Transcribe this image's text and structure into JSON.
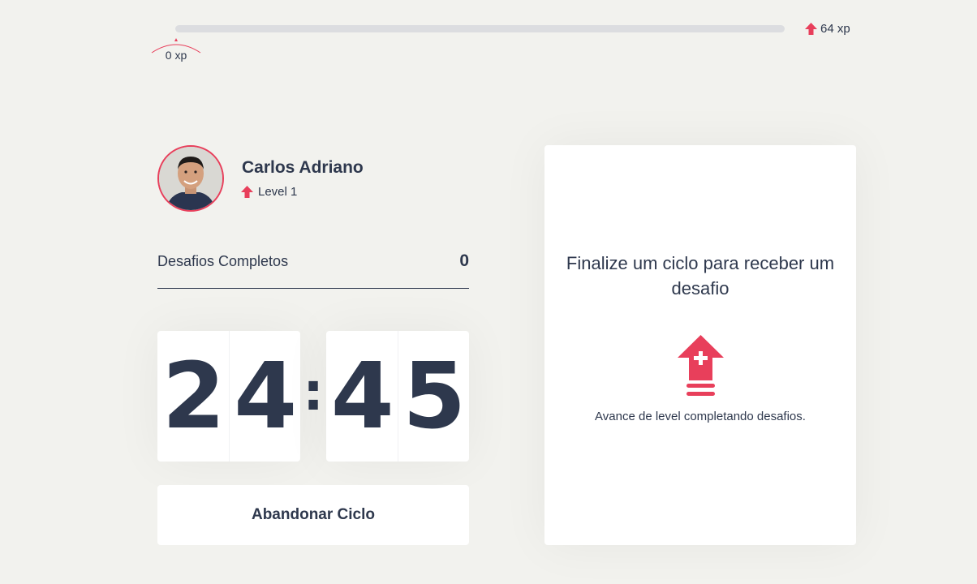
{
  "experience": {
    "current": "0 xp",
    "max": "64 xp",
    "progress_fraction": 0
  },
  "profile": {
    "name": "Carlos Adriano",
    "level": "Level 1"
  },
  "completed_challenges": {
    "label": "Desafios Completos",
    "count": "0"
  },
  "countdown": {
    "minutes": [
      "2",
      "4"
    ],
    "separator": ":",
    "seconds": [
      "4",
      "5"
    ]
  },
  "abandon_button": {
    "label": "Abandonar Ciclo"
  },
  "challenge_box": {
    "title": "Finalize um ciclo para receber um desafio",
    "description": "Avance de level completando desafios."
  },
  "colors": {
    "accent_red": "#e83f5b",
    "text_dark": "#2e384d",
    "background": "#f2f2ee"
  }
}
